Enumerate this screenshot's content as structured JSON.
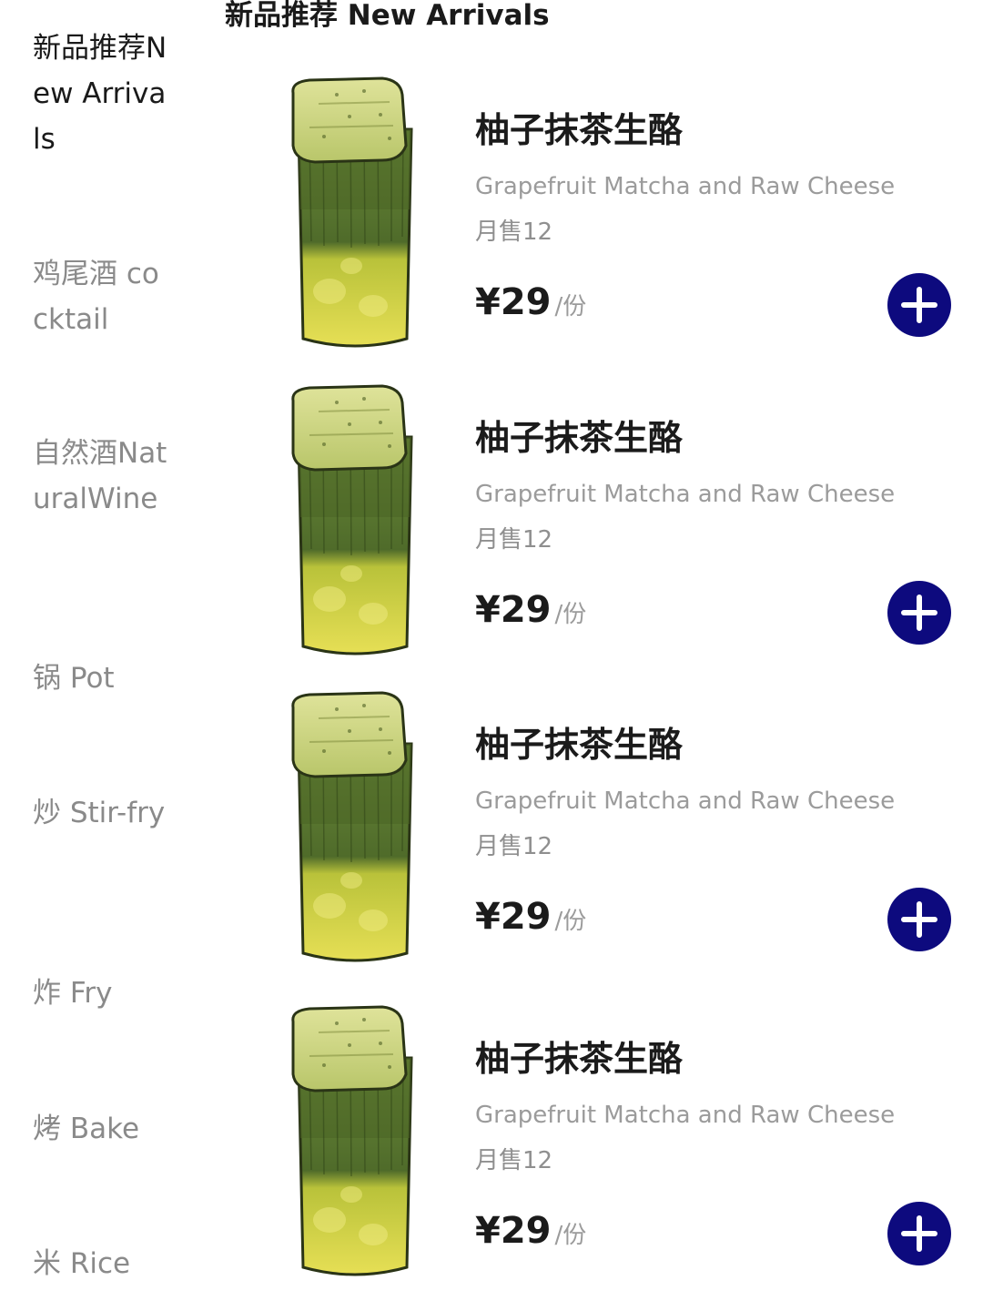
{
  "sidebar": {
    "categories": [
      {
        "label": "新品推荐New Arrivals",
        "active": true
      },
      {
        "label": "鸡尾酒 cocktail",
        "active": false
      },
      {
        "label": "自然酒NaturalWine",
        "active": false
      },
      {
        "label": "锅 Pot",
        "active": false
      },
      {
        "label": "炒 Stir-fry",
        "active": false
      },
      {
        "label": "炸 Fry",
        "active": false
      },
      {
        "label": "烤 Bake",
        "active": false
      },
      {
        "label": "米 Rice",
        "active": false
      }
    ]
  },
  "section": {
    "title": "新品推荐 New Arrivals"
  },
  "products": [
    {
      "name": "柚子抹茶生酪",
      "subtitle": "Grapefruit Matcha and Raw Cheese",
      "sales": "月售12",
      "price": "¥29",
      "unit": "/份"
    },
    {
      "name": "柚子抹茶生酪",
      "subtitle": "Grapefruit Matcha and Raw Cheese",
      "sales": "月售12",
      "price": "¥29",
      "unit": "/份"
    },
    {
      "name": "柚子抹茶生酪",
      "subtitle": "Grapefruit Matcha and Raw Cheese",
      "sales": "月售12",
      "price": "¥29",
      "unit": "/份"
    },
    {
      "name": "柚子抹茶生酪",
      "subtitle": "Grapefruit Matcha and Raw Cheese",
      "sales": "月售12",
      "price": "¥29",
      "unit": "/份"
    }
  ],
  "icons": {
    "add": "plus-icon",
    "product_image": "matcha-drink-cup"
  },
  "colors": {
    "accent": "#0d0a7e",
    "text_primary": "#1b1b1b",
    "text_secondary": "#9b9b9b"
  }
}
